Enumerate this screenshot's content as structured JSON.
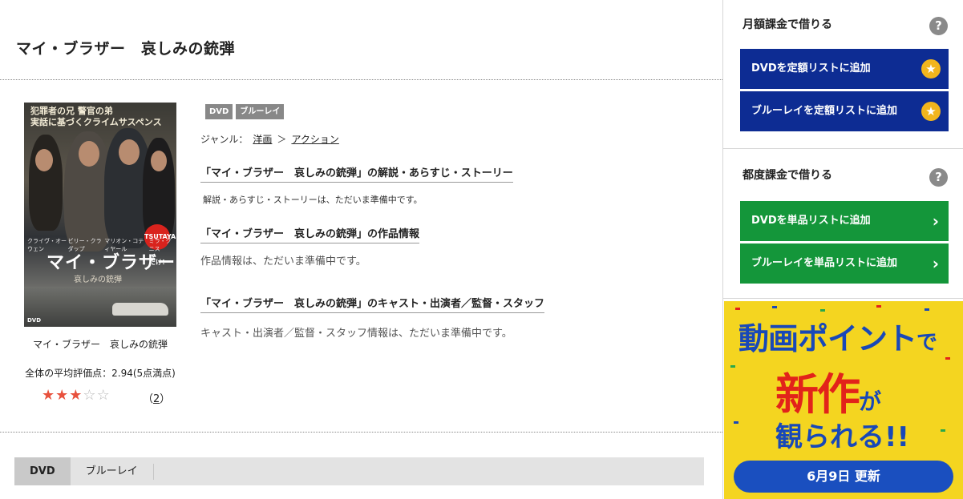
{
  "main": {
    "title": "マイ・ブラザー　哀しみの銃弾",
    "poster": {
      "tagline_1": "犯罪者の兄",
      "tagline_2": "警官の弟",
      "tagline_3": "実話に基づくクライムサスペンス",
      "cast": [
        "クライヴ・オーウェン",
        "ビリー・クラダップ",
        "マリオン・コティヤール",
        "ミラ・クニス"
      ],
      "badge": "TSUTAYAだけ!",
      "title": "マイ・ブラザー",
      "subtitle": "哀しみの銃弾",
      "dvd_mark": "DVD"
    },
    "poster_caption": "マイ・ブラザー　哀しみの銃弾",
    "rating_text": "全体の平均評価点：2.94(5点満点)",
    "rating": {
      "filled": 3,
      "total": 5,
      "value": 2.94,
      "max": 5
    },
    "review_count_open": "（",
    "review_count": "2",
    "review_count_close": "）",
    "tags": [
      "DVD",
      "ブルーレイ"
    ],
    "genre_label": "ジャンル：",
    "genre_link_1": "洋画",
    "genre_sep": "＞",
    "genre_link_2": "アクション",
    "section1_title": "「マイ・ブラザー　哀しみの銃弾」の解説・あらすじ・ストーリー",
    "section1_body": "解説・あらすじ・ストーリーは、ただいま準備中です。",
    "section2_title": "「マイ・ブラザー　哀しみの銃弾」の作品情報",
    "section2_body": "作品情報は、ただいま準備中です。",
    "section3_title": "「マイ・ブラザー　哀しみの銃弾」のキャスト・出演者／監督・スタッフ",
    "section3_body": "キャスト・出演者／監督・スタッフ情報は、ただいま準備中です。",
    "tabs": [
      {
        "label": "DVD",
        "active": true
      },
      {
        "label": "ブルーレイ",
        "active": false
      }
    ]
  },
  "sidebar": {
    "monthly_heading": "月額課金で借りる",
    "help_glyph": "?",
    "btn_dvd_monthly": "DVDを定額リストに追加",
    "btn_bluray_monthly": "ブルーレイを定額リストに追加",
    "per_heading": "都度課金で借りる",
    "btn_dvd_single": "DVDを単品リストに追加",
    "btn_bluray_single": "ブルーレイを単品リストに追加",
    "star_glyph": "★",
    "chevron_glyph": "›",
    "colors": {
      "blue_button": "#0d2c93",
      "green_button": "#14963a",
      "star": "#f2b51d"
    }
  },
  "banner": {
    "line1_a": "動画ポイント",
    "line1_b": "で",
    "line2_a": "新作",
    "line2_b": "が",
    "line3": "観られる!!",
    "update": "6月9日 更新",
    "colors": {
      "bg": "#f4d520",
      "blue": "#1848b8",
      "red": "#e2231a"
    }
  }
}
